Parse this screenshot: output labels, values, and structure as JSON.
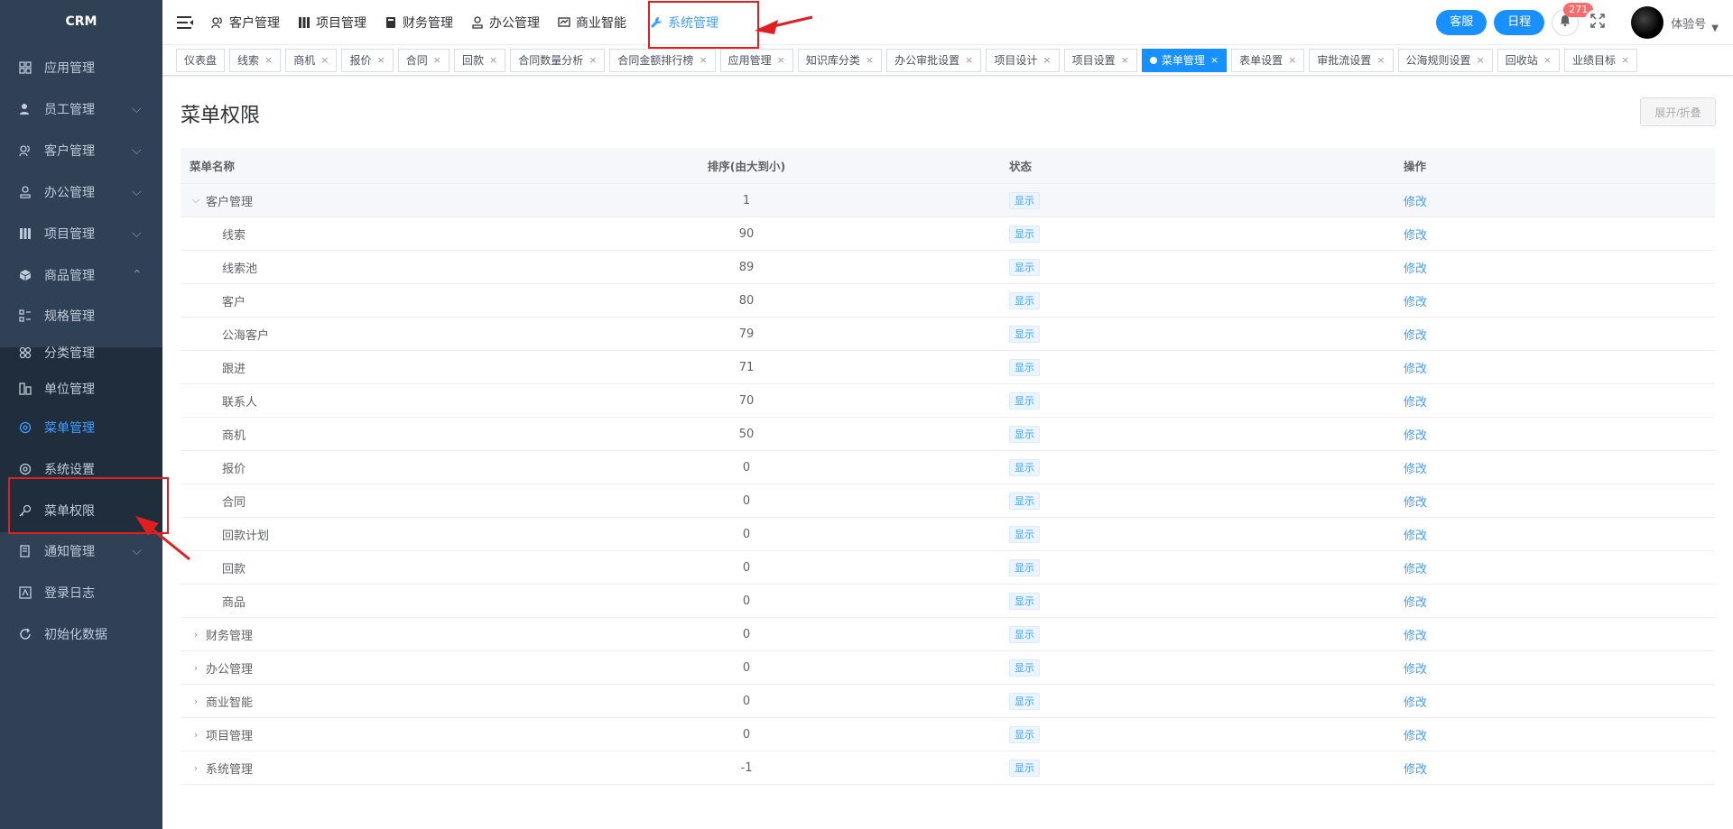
{
  "app": {
    "logo": "CRM"
  },
  "sidebar": {
    "items": [
      {
        "label": "应用管理",
        "icon": "grid-icon",
        "arrow": ""
      },
      {
        "label": "员工管理",
        "icon": "user-icon",
        "arrow": "⌵"
      },
      {
        "label": "客户管理",
        "icon": "customers-icon",
        "arrow": "⌵"
      },
      {
        "label": "办公管理",
        "icon": "office-icon",
        "arrow": "⌵"
      },
      {
        "label": "项目管理",
        "icon": "project-icon",
        "arrow": "⌵"
      },
      {
        "label": "商品管理",
        "icon": "cube-icon",
        "arrow": "⌃"
      },
      {
        "label": "规格管理",
        "icon": "spec-icon",
        "arrow": ""
      },
      {
        "label": "分类管理",
        "icon": "category-icon",
        "arrow": ""
      },
      {
        "label": "单位管理",
        "icon": "unit-icon",
        "arrow": ""
      },
      {
        "label": "菜单管理",
        "icon": "menu-icon",
        "arrow": ""
      },
      {
        "label": "系统设置",
        "icon": "settings-icon",
        "arrow": ""
      },
      {
        "label": "菜单权限",
        "icon": "key-icon",
        "arrow": ""
      },
      {
        "label": "通知管理",
        "icon": "notice-icon",
        "arrow": "⌵"
      },
      {
        "label": "登录日志",
        "icon": "log-icon",
        "arrow": ""
      },
      {
        "label": "初始化数据",
        "icon": "refresh-icon",
        "arrow": ""
      }
    ]
  },
  "topnav": {
    "items": [
      {
        "label": "客户管理",
        "icon": "customers-icon"
      },
      {
        "label": "项目管理",
        "icon": "project-icon"
      },
      {
        "label": "财务管理",
        "icon": "finance-icon"
      },
      {
        "label": "办公管理",
        "icon": "office-icon"
      },
      {
        "label": "商业智能",
        "icon": "bi-icon"
      },
      {
        "label": "系统管理",
        "icon": "wrench-icon"
      }
    ],
    "service_label": "客服",
    "schedule_label": "日程",
    "notification_count": "271",
    "username": "体验号"
  },
  "tags": [
    {
      "label": "仪表盘",
      "closable": false
    },
    {
      "label": "线索",
      "closable": true
    },
    {
      "label": "商机",
      "closable": true
    },
    {
      "label": "报价",
      "closable": true
    },
    {
      "label": "合同",
      "closable": true
    },
    {
      "label": "回款",
      "closable": true
    },
    {
      "label": "合同数量分析",
      "closable": true
    },
    {
      "label": "合同金额排行榜",
      "closable": true
    },
    {
      "label": "应用管理",
      "closable": true
    },
    {
      "label": "知识库分类",
      "closable": true
    },
    {
      "label": "办公审批设置",
      "closable": true
    },
    {
      "label": "项目设计",
      "closable": true
    },
    {
      "label": "项目设置",
      "closable": true
    },
    {
      "label": "菜单管理",
      "closable": true,
      "active": true
    },
    {
      "label": "表单设置",
      "closable": true
    },
    {
      "label": "审批流设置",
      "closable": true
    },
    {
      "label": "公海规则设置",
      "closable": true
    },
    {
      "label": "回收站",
      "closable": true
    },
    {
      "label": "业绩目标",
      "closable": true
    }
  ],
  "page": {
    "title": "菜单权限",
    "toggle_label": "展开/折叠"
  },
  "table": {
    "headers": [
      "菜单名称",
      "排序(由大到小)",
      "状态",
      "操作"
    ],
    "rows": [
      {
        "name": "客户管理",
        "order": "1",
        "status": "显示",
        "action": "修改",
        "expand": "⌵",
        "level": 0
      },
      {
        "name": "线索",
        "order": "90",
        "status": "显示",
        "action": "修改",
        "expand": "",
        "level": 1
      },
      {
        "name": "线索池",
        "order": "89",
        "status": "显示",
        "action": "修改",
        "expand": "",
        "level": 1
      },
      {
        "name": "客户",
        "order": "80",
        "status": "显示",
        "action": "修改",
        "expand": "",
        "level": 1
      },
      {
        "name": "公海客户",
        "order": "79",
        "status": "显示",
        "action": "修改",
        "expand": "",
        "level": 1
      },
      {
        "name": "跟进",
        "order": "71",
        "status": "显示",
        "action": "修改",
        "expand": "",
        "level": 1
      },
      {
        "name": "联系人",
        "order": "70",
        "status": "显示",
        "action": "修改",
        "expand": "",
        "level": 1
      },
      {
        "name": "商机",
        "order": "50",
        "status": "显示",
        "action": "修改",
        "expand": "",
        "level": 1
      },
      {
        "name": "报价",
        "order": "0",
        "status": "显示",
        "action": "修改",
        "expand": "",
        "level": 1
      },
      {
        "name": "合同",
        "order": "0",
        "status": "显示",
        "action": "修改",
        "expand": "",
        "level": 1
      },
      {
        "name": "回款计划",
        "order": "0",
        "status": "显示",
        "action": "修改",
        "expand": "",
        "level": 1
      },
      {
        "name": "回款",
        "order": "0",
        "status": "显示",
        "action": "修改",
        "expand": "",
        "level": 1
      },
      {
        "name": "商品",
        "order": "0",
        "status": "显示",
        "action": "修改",
        "expand": "",
        "level": 1
      },
      {
        "name": "财务管理",
        "order": "0",
        "status": "显示",
        "action": "修改",
        "expand": "›",
        "level": 0
      },
      {
        "name": "办公管理",
        "order": "0",
        "status": "显示",
        "action": "修改",
        "expand": "›",
        "level": 0
      },
      {
        "name": "商业智能",
        "order": "0",
        "status": "显示",
        "action": "修改",
        "expand": "›",
        "level": 0
      },
      {
        "name": "项目管理",
        "order": "0",
        "status": "显示",
        "action": "修改",
        "expand": "›",
        "level": 0
      },
      {
        "name": "系统管理",
        "order": "-1",
        "status": "显示",
        "action": "修改",
        "expand": "›",
        "level": 0
      }
    ]
  },
  "colors": {
    "sidebar_bg": "#304156",
    "accent": "#409eff",
    "annotation": "#e02020"
  }
}
